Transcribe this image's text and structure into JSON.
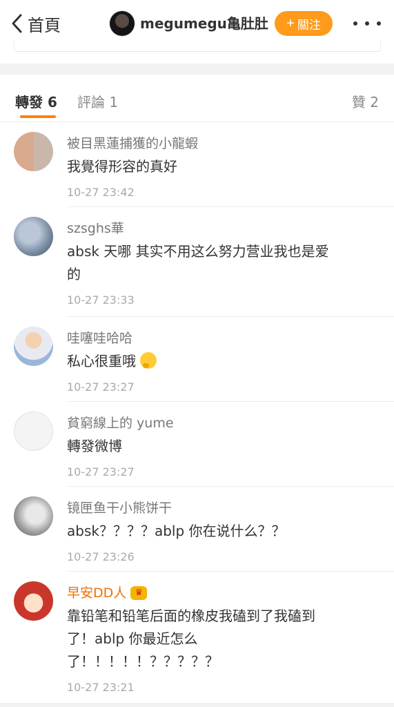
{
  "header": {
    "back_label": "首頁",
    "user_name": "megumegu亀肚肚",
    "follow_label": "關注",
    "follow_plus": "+"
  },
  "tabs": {
    "repost": "轉發 6",
    "comment": "評論 1",
    "like": "贊 2"
  },
  "items": [
    {
      "user": "被目黑蓮捕獲的小龍蝦",
      "text": "我覺得形容的真好",
      "time": "10-27 23:42"
    },
    {
      "user": "szsghs華",
      "text_line1": "absk 天哪 其实不用这么努力营业我也是爱",
      "text_line2": "的",
      "time": "10-27 23:33"
    },
    {
      "user": "哇噻哇哈哈",
      "text": "私心很重哦",
      "time": "10-27 23:27"
    },
    {
      "user": "貧窮線上的 yume",
      "text": "轉發微博",
      "time": "10-27 23:27"
    },
    {
      "user": "镜匣鱼干小熊饼干",
      "text": "absk？？？？ablp 你在说什么？？",
      "time": "10-27 23:26"
    },
    {
      "user": "早安DD人",
      "text_line1": "靠铅笔和铅笔后面的橡皮我磕到了我磕到",
      "text_line2": "了！ablp 你最近怎么",
      "text_line3": "了！！！！！？？？？？",
      "time": "10-27 23:21",
      "badge": "♛"
    }
  ]
}
